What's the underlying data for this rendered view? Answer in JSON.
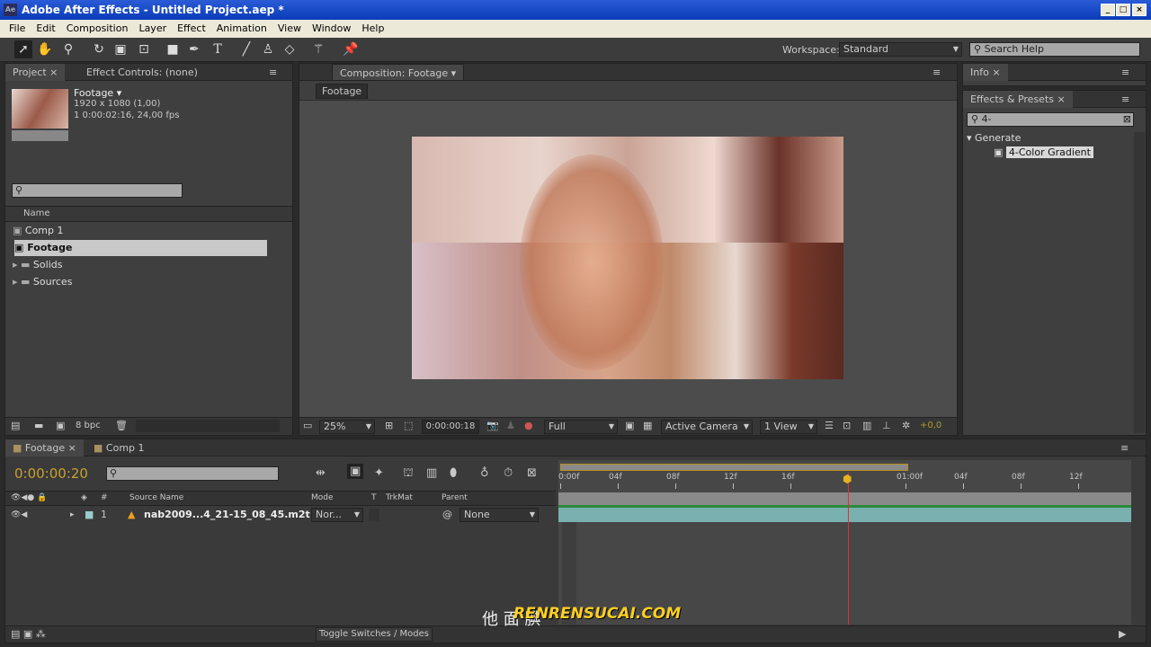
{
  "window": {
    "title": "Adobe After Effects - Untitled Project.aep *",
    "logo": "Ae"
  },
  "menu": [
    "File",
    "Edit",
    "Composition",
    "Layer",
    "Effect",
    "Animation",
    "View",
    "Window",
    "Help"
  ],
  "toolbar": {
    "tools": [
      "selection-tool",
      "hand-tool",
      "zoom-tool",
      "rotate-tool",
      "camera-tool",
      "pan-behind-tool",
      "rectangle-tool",
      "pen-tool",
      "text-tool",
      "brush-tool",
      "clone-stamp-tool",
      "eraser-tool",
      "roto-brush-tool",
      "puppet-pin-tool"
    ],
    "workspace_label": "Workspace:",
    "workspace_value": "Standard",
    "search_help_placeholder": "Search Help"
  },
  "project": {
    "tab": "Project",
    "tab2": "Effect Controls: (none)",
    "item_name": "Footage ▾",
    "item_dims": "1920 x 1080 (1,00)",
    "item_duration": "1 0:00:02:16, 24,00 fps",
    "col_name": "Name",
    "items": [
      {
        "name": "Comp 1",
        "type": "comp"
      },
      {
        "name": "Footage",
        "type": "comp",
        "selected": true
      },
      {
        "name": "Solids",
        "type": "folder"
      },
      {
        "name": "Sources",
        "type": "folder"
      }
    ],
    "bpc": "8 bpc"
  },
  "composition": {
    "tab": "Composition: Footage",
    "breadcrumb": "Footage",
    "zoom": "25%",
    "timecode": "0:00:00:18",
    "resolution": "Full",
    "camera": "Active Camera",
    "views": "1 View",
    "exposure": "+0,0"
  },
  "info": {
    "tab": "Info"
  },
  "effects": {
    "tab": "Effects & Presets",
    "search": "4-",
    "category": "Generate",
    "item": "4-Color Gradient"
  },
  "timeline": {
    "tabs": [
      "Footage",
      "Comp 1"
    ],
    "timecode": "0:00:00:20",
    "columns": [
      "#",
      "Source Name",
      "Mode",
      "T",
      "TrkMat",
      "Parent"
    ],
    "layers": [
      {
        "num": "1",
        "name": "nab2009...4_21-15_08_45.m2t",
        "mode": "Nor...",
        "parent": "None"
      }
    ],
    "ruler": [
      "0:00f",
      "04f",
      "08f",
      "12f",
      "16f",
      "20f",
      "01:00f",
      "04f",
      "08f",
      "12f"
    ],
    "toggle": "Toggle Switches / Modes",
    "playhead_frame": 20
  },
  "watermark": {
    "text": "他 面 腆",
    "logo": "RENRENSUCAI.COM"
  }
}
